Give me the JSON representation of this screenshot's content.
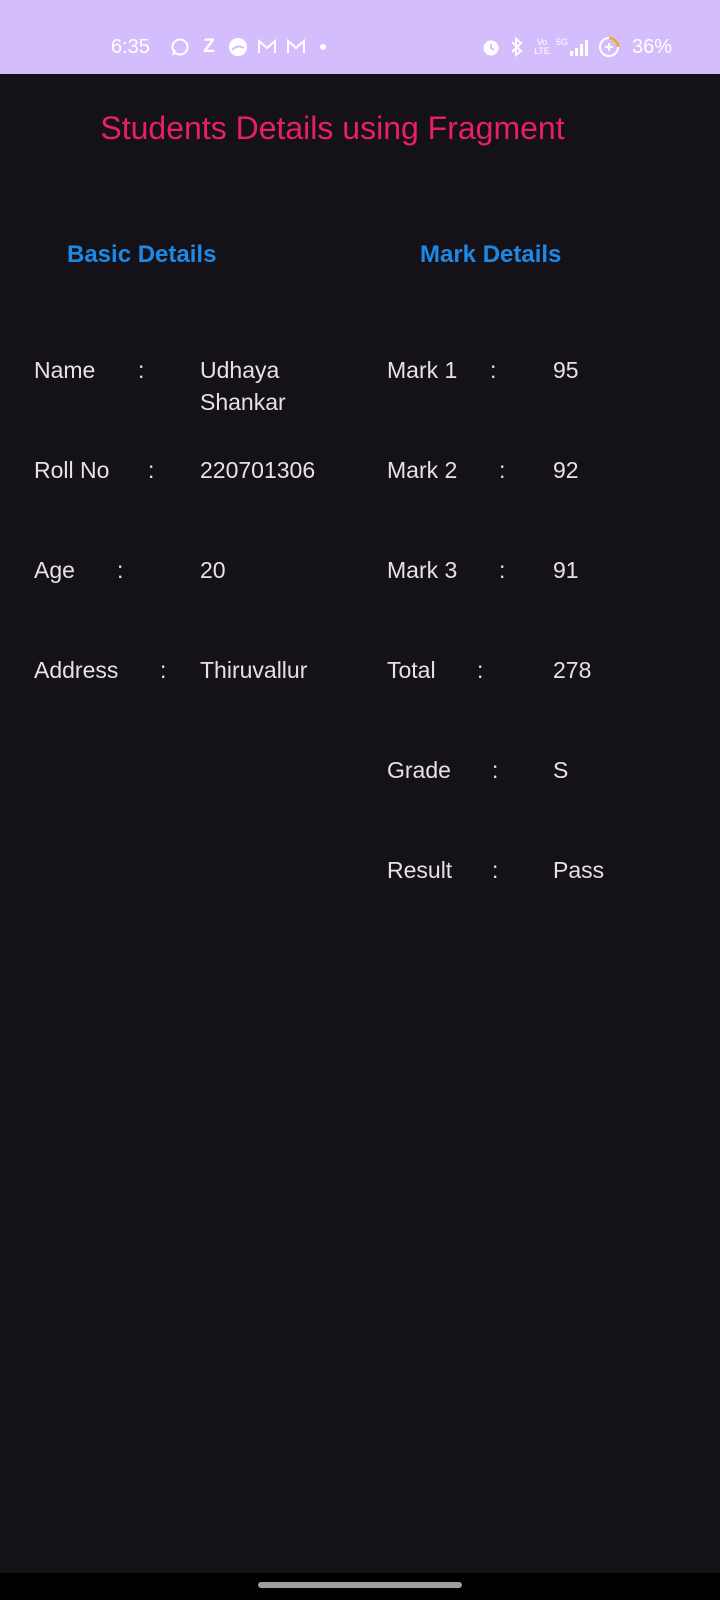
{
  "status_bar": {
    "time": "6:35",
    "battery": "36%",
    "left_icons": [
      "whatsapp-icon",
      "z-app-icon",
      "weather-icon",
      "gmail-icon",
      "gmail-icon",
      "dot-icon"
    ],
    "right_icons": [
      "alarm-icon",
      "bluetooth-icon",
      "volte-icon",
      "5g-signal-icon",
      "battery-saver-icon"
    ],
    "background": "#d3bdfd"
  },
  "app": {
    "title": "Students Details using Fragment",
    "title_color": "#e91e63",
    "background": "#141218"
  },
  "basic_details": {
    "heading": "Basic Details",
    "rows": [
      {
        "label": "Name",
        "colon": ":",
        "value": "Udhaya Shankar"
      },
      {
        "label": "Roll No",
        "colon": ":",
        "value": "220701306"
      },
      {
        "label": "Age",
        "colon": ":",
        "value": "20"
      },
      {
        "label": "Address",
        "colon": ":",
        "value": "Thiruvallur"
      }
    ]
  },
  "mark_details": {
    "heading": "Mark Details",
    "rows": [
      {
        "label": "Mark 1",
        "colon": ":",
        "value": "95"
      },
      {
        "label": "Mark 2",
        "colon": ":",
        "value": "92"
      },
      {
        "label": "Mark 3",
        "colon": ":",
        "value": "91"
      },
      {
        "label": "Total",
        "colon": ":",
        "value": "278"
      },
      {
        "label": "Grade",
        "colon": ":",
        "value": "S"
      },
      {
        "label": "Result",
        "colon": ":",
        "value": "Pass"
      }
    ]
  },
  "colors": {
    "heading": "#1e88e5",
    "text": "#e6e1e6"
  }
}
